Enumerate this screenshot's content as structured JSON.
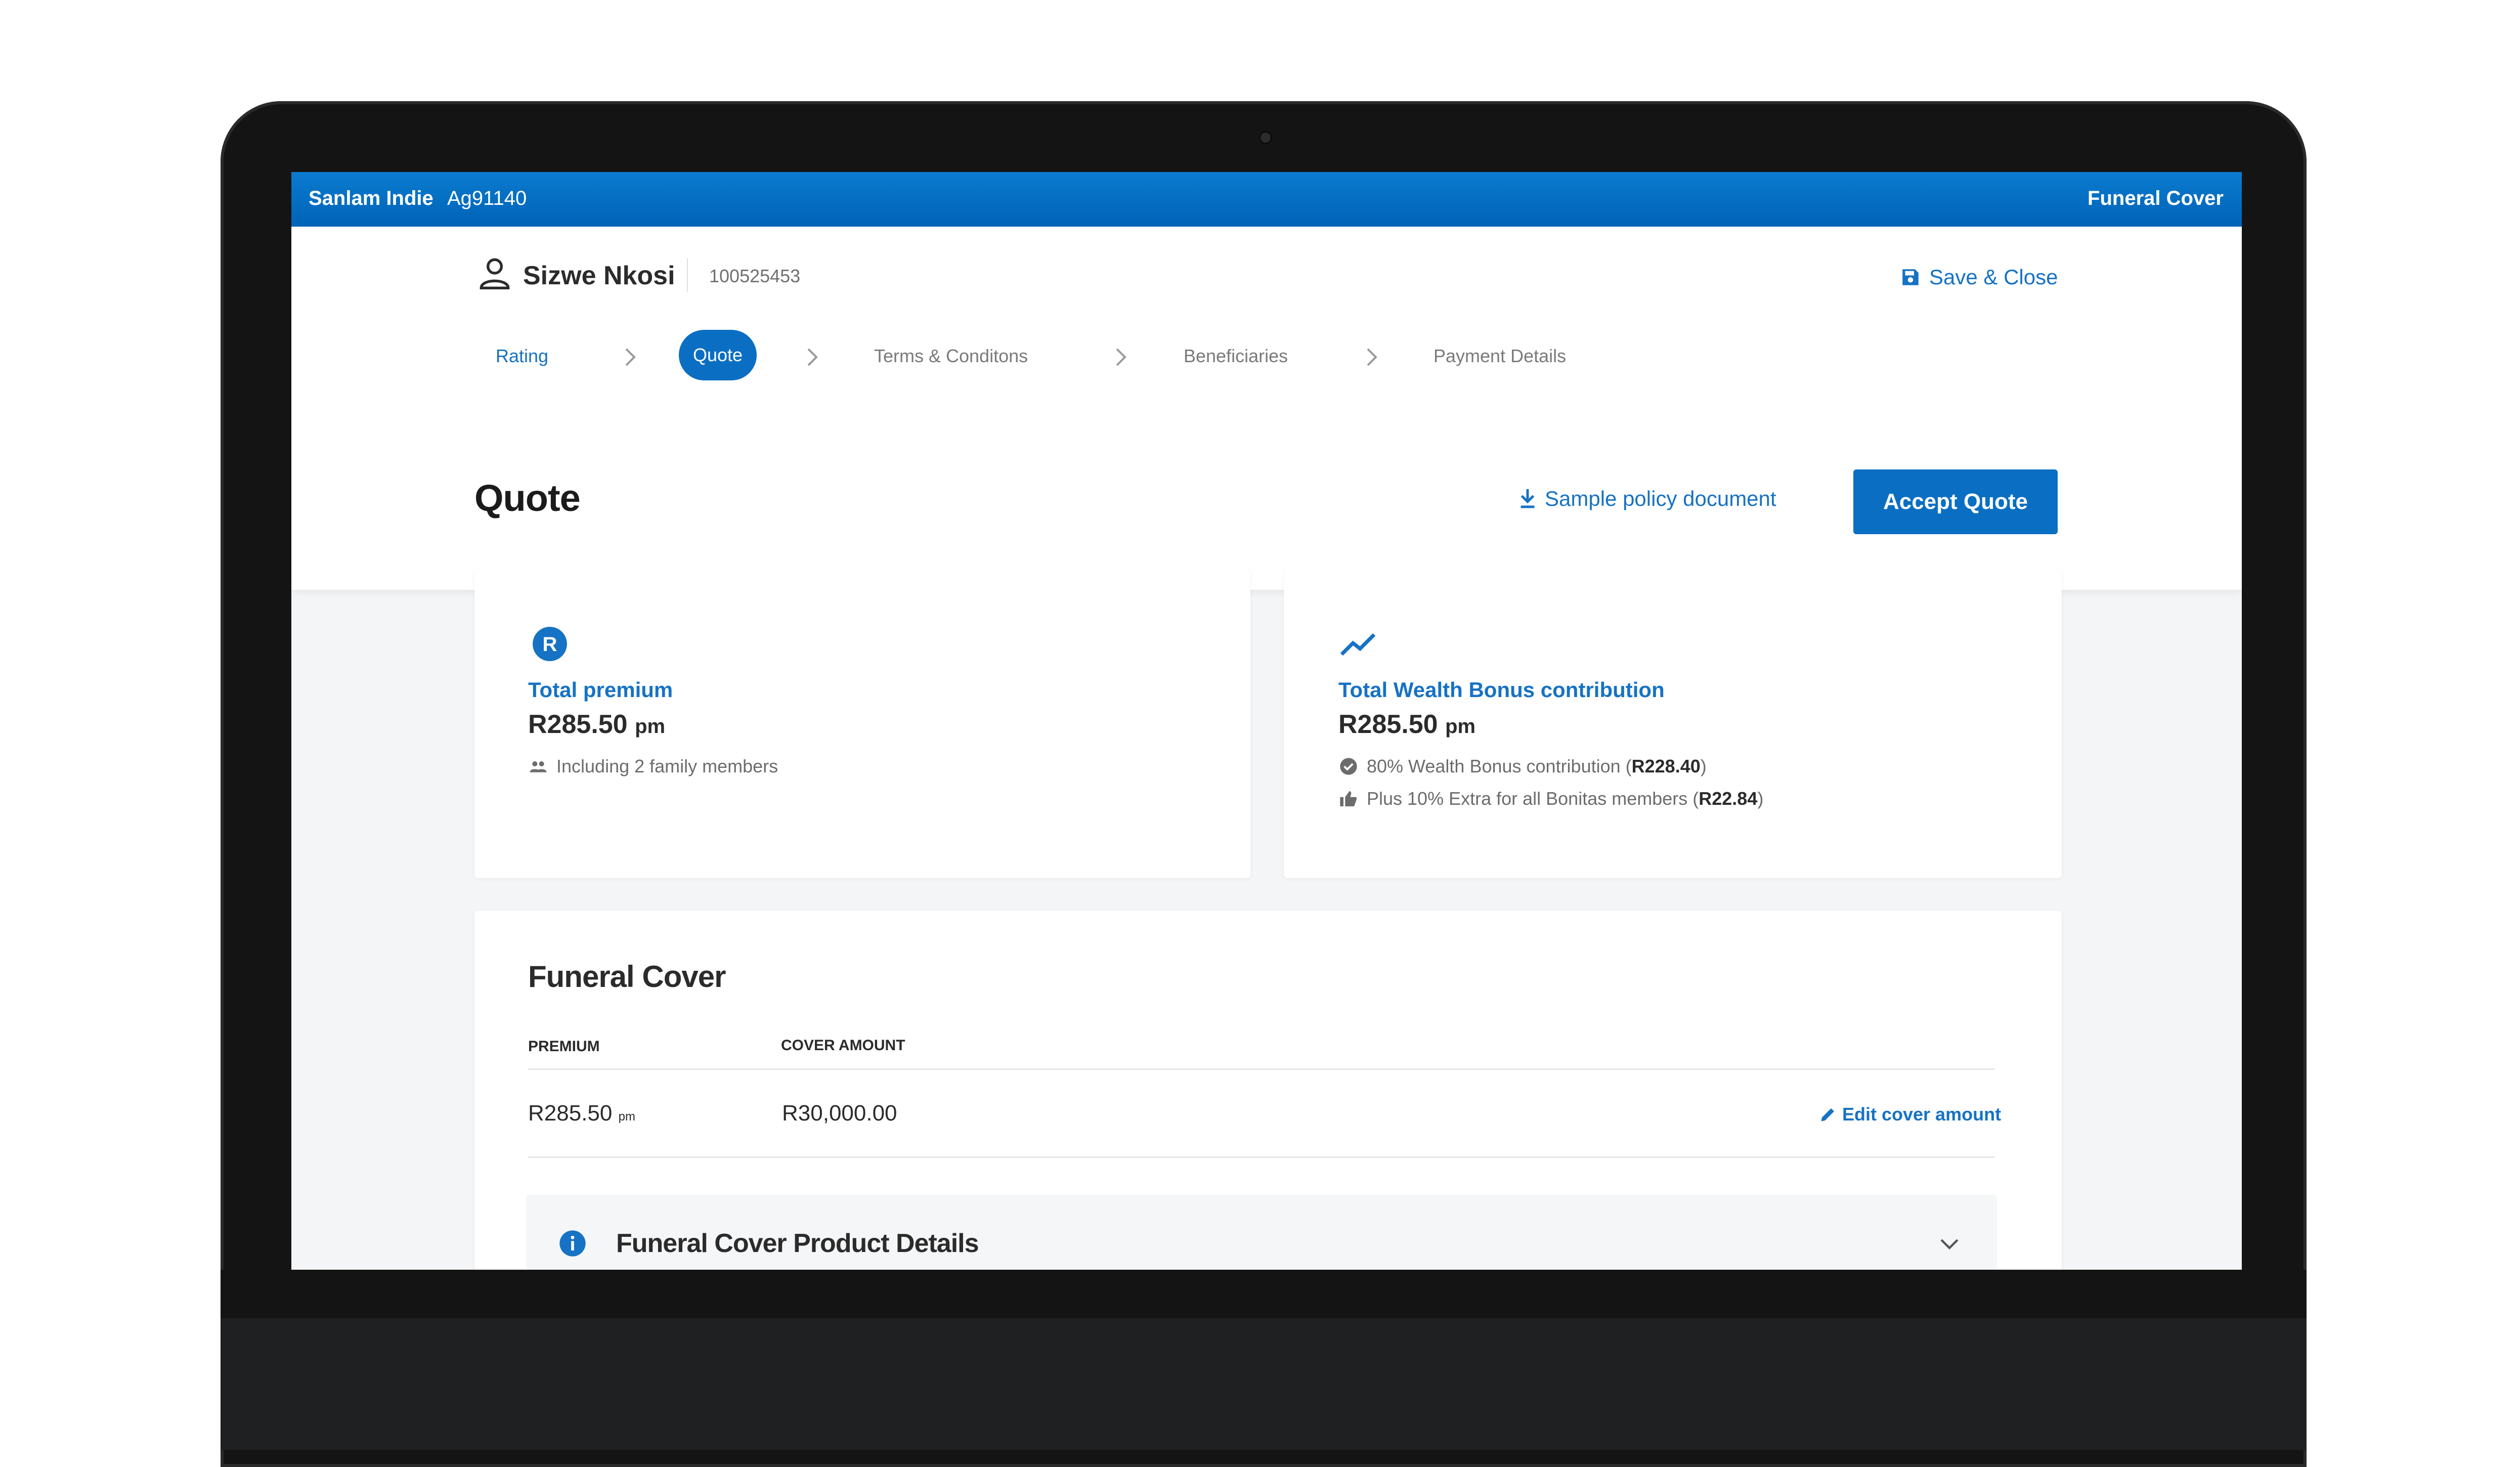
{
  "topbar": {
    "brand": "Sanlam Indie",
    "agent_code": "Ag91140",
    "product": "Funeral Cover"
  },
  "client": {
    "name": "Sizwe Nkosi",
    "id": "100525453",
    "icon": "user-icon"
  },
  "actions": {
    "save_close": "Save & Close",
    "sample_doc": "Sample policy document",
    "accept_quote": "Accept Quote"
  },
  "steps": [
    {
      "label": "Rating",
      "state": "done"
    },
    {
      "label": "Quote",
      "state": "active"
    },
    {
      "label": "Terms & Conditons",
      "state": "pending"
    },
    {
      "label": "Beneficiaries",
      "state": "pending"
    },
    {
      "label": "Payment Details",
      "state": "pending"
    }
  ],
  "page": {
    "title": "Quote"
  },
  "cards": {
    "premium": {
      "icon_letter": "R",
      "label": "Total premium",
      "amount": "R285.50",
      "unit": "pm",
      "meta": "Including 2 family members"
    },
    "wealth": {
      "label": "Total Wealth Bonus contribution",
      "amount": "R285.50",
      "unit": "pm",
      "line1_text": "80% Wealth Bonus contribution (",
      "line1_value": "R228.40",
      "line1_close": ")",
      "line2_text": "Plus 10% Extra for all Bonitas members (",
      "line2_value": "R22.84",
      "line2_close": ")"
    }
  },
  "funeral": {
    "title": "Funeral Cover",
    "col_premium": "PREMIUM",
    "col_cover": "COVER AMOUNT",
    "premium_value": "R285.50",
    "premium_unit": "pm",
    "cover_value": "R30,000.00",
    "edit_label": "Edit cover amount",
    "details_title": "Funeral Cover Product Details"
  },
  "colors": {
    "accent": "#0a6fc2",
    "link": "#1672c4",
    "topbar": "#0063b8"
  }
}
